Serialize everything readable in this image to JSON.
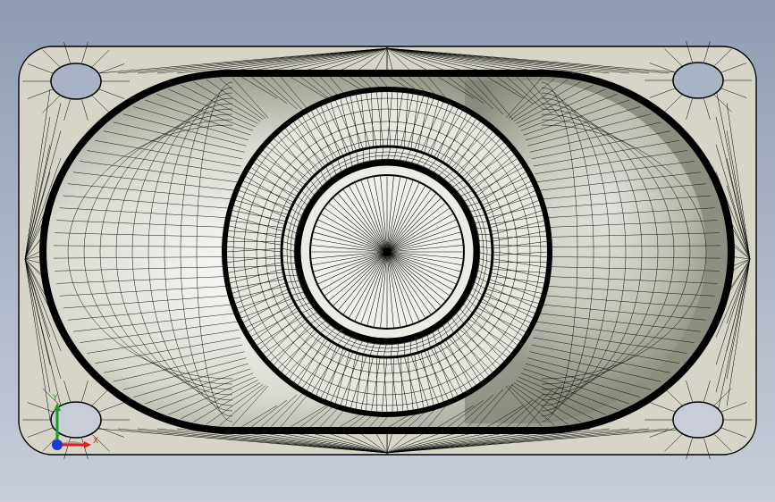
{
  "viewport": {
    "title": "",
    "background_top": "#8e9cb4",
    "background_bottom": "#c8cdd8"
  },
  "model": {
    "view": "top",
    "display_mode": "wireframe-mesh-with-shading",
    "plate_color": "#d6d5c8",
    "edge_color": "#000000",
    "features": [
      "rounded-rectangular-plate",
      "stadium-shaped-recess",
      "central-ring-boss",
      "four-corner-slots",
      "center-hole"
    ]
  },
  "triad": {
    "x_label": "X",
    "y_label": "Y",
    "x_color": "#e02020",
    "y_color": "#18a018",
    "z_color": "#1a3ad0"
  }
}
